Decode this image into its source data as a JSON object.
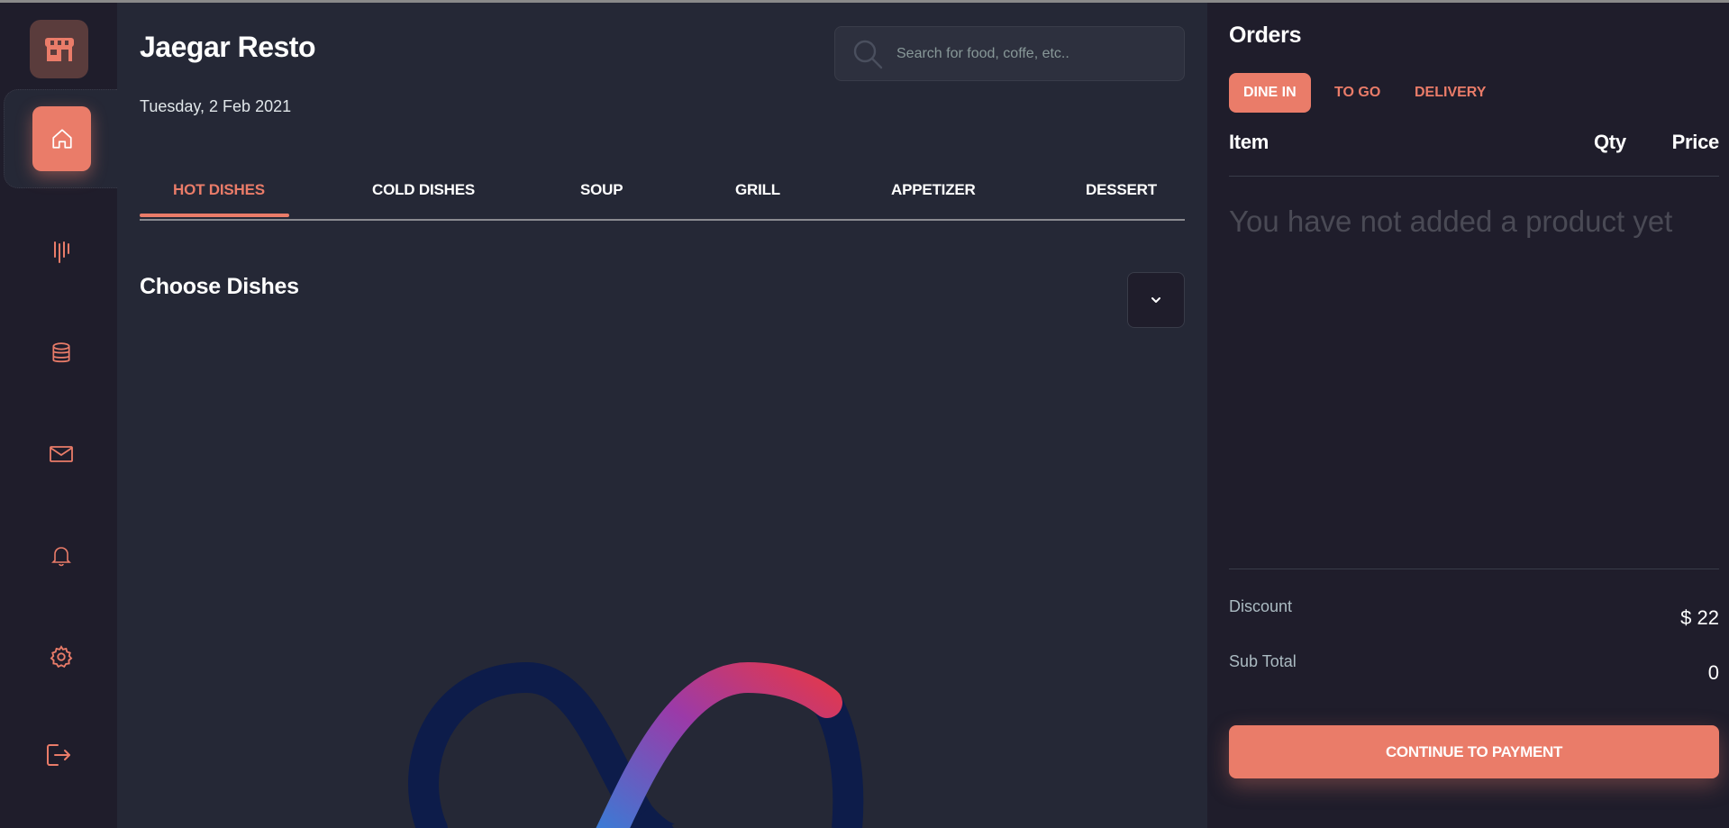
{
  "app": {
    "title": "Jaegar Resto",
    "date": "Tuesday, 2 Feb 2021"
  },
  "sidebar": {
    "logo_icon": "store-icon",
    "items": [
      {
        "icon": "home-icon",
        "active": true
      },
      {
        "icon": "chart-bars-icon"
      },
      {
        "icon": "database-icon"
      },
      {
        "icon": "mail-icon"
      },
      {
        "icon": "bell-icon"
      },
      {
        "icon": "gear-icon"
      },
      {
        "icon": "logout-icon"
      }
    ]
  },
  "search": {
    "placeholder": "Search for food, coffe, etc.."
  },
  "tabs": [
    "HOT DISHES",
    "COLD DISHES",
    "SOUP",
    "GRILL",
    "APPETIZER",
    "DESSERT"
  ],
  "main": {
    "section_title": "Choose Dishes",
    "dropdown_icon": "chevron-down-icon"
  },
  "orders": {
    "title": "Orders",
    "types": [
      "DINE IN",
      "TO GO",
      "DELIVERY"
    ],
    "columns": {
      "item": "Item",
      "qty": "Qty",
      "price": "Price"
    },
    "empty_message": "You have not added a product yet",
    "discount_label": "Discount",
    "discount_value": "$ 22",
    "subtotal_label": "Sub Total",
    "subtotal_value": "0",
    "pay_button": "CONTINUE TO PAYMENT"
  },
  "colors": {
    "accent": "#ea7c69",
    "background": "#252836",
    "panel": "#1f1d2b"
  }
}
